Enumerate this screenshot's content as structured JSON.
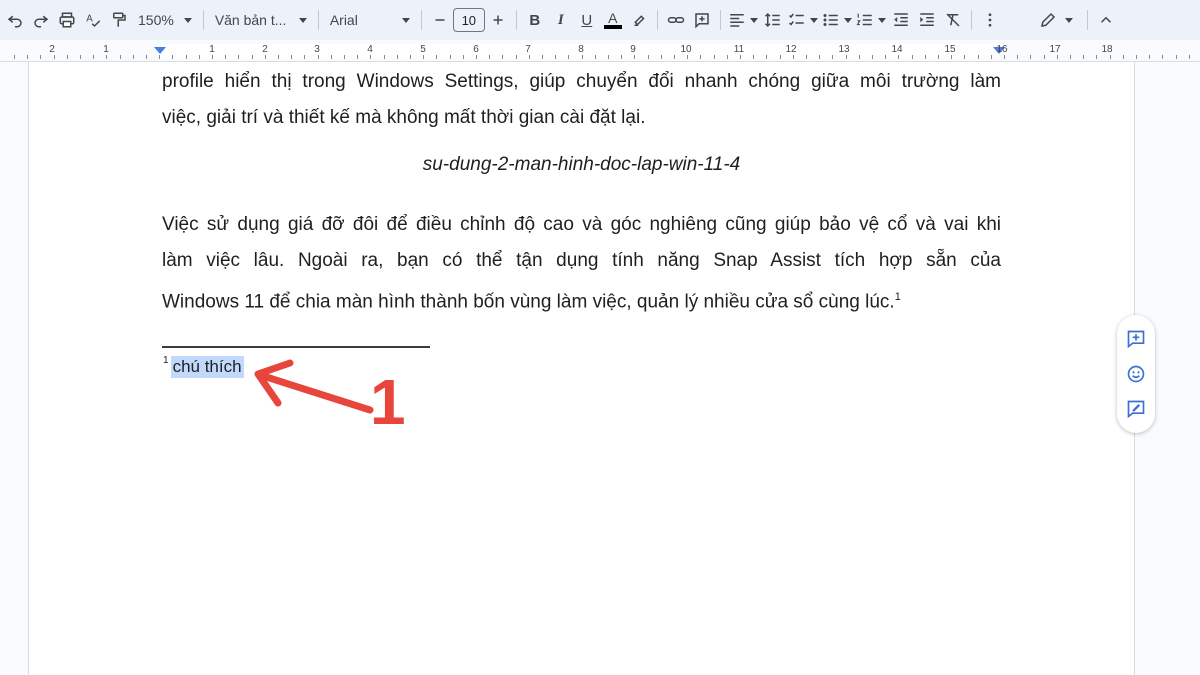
{
  "toolbar": {
    "zoom": "150%",
    "style": "Văn bản t...",
    "font": "Arial",
    "font_size": "10",
    "bold": "B",
    "italic": "I",
    "underline": "U",
    "text_color": "A"
  },
  "ruler": {
    "labels": [
      "2",
      "1",
      "1",
      "2",
      "3",
      "4",
      "5",
      "6",
      "7",
      "8",
      "9",
      "10",
      "11",
      "12",
      "13",
      "14",
      "15",
      "16",
      "17",
      "18"
    ]
  },
  "document": {
    "para1_lines": [
      "profile hiển thị trong Windows Settings, giúp chuyển đổi nhanh chóng giữa môi trường làm",
      "việc, giải trí và thiết kế mà không mất thời gian cài đặt lại."
    ],
    "caption": "su-dung-2-man-hinh-doc-lap-win-11-4",
    "para2_lines": [
      "Việc sử dụng giá đỡ đôi để điều chỉnh độ cao và góc nghiêng cũng giúp bảo vệ cổ và vai khi",
      "làm việc lâu. Ngoài ra, bạn có thể tận dụng tính năng Snap Assist tích hợp sẵn của",
      "Windows 11 để chia màn hình thành bốn vùng làm việc, quản lý nhiều cửa sổ cùng lúc."
    ],
    "footnote_ref": "1",
    "footnote_number": "1",
    "footnote_text": "chú thích"
  },
  "annotation": {
    "number": "1",
    "color": "#e8453c"
  },
  "colors": {
    "toolbar_bg": "#edf2fa",
    "selection": "#c3d9fb",
    "accent": "#4a7de0"
  }
}
